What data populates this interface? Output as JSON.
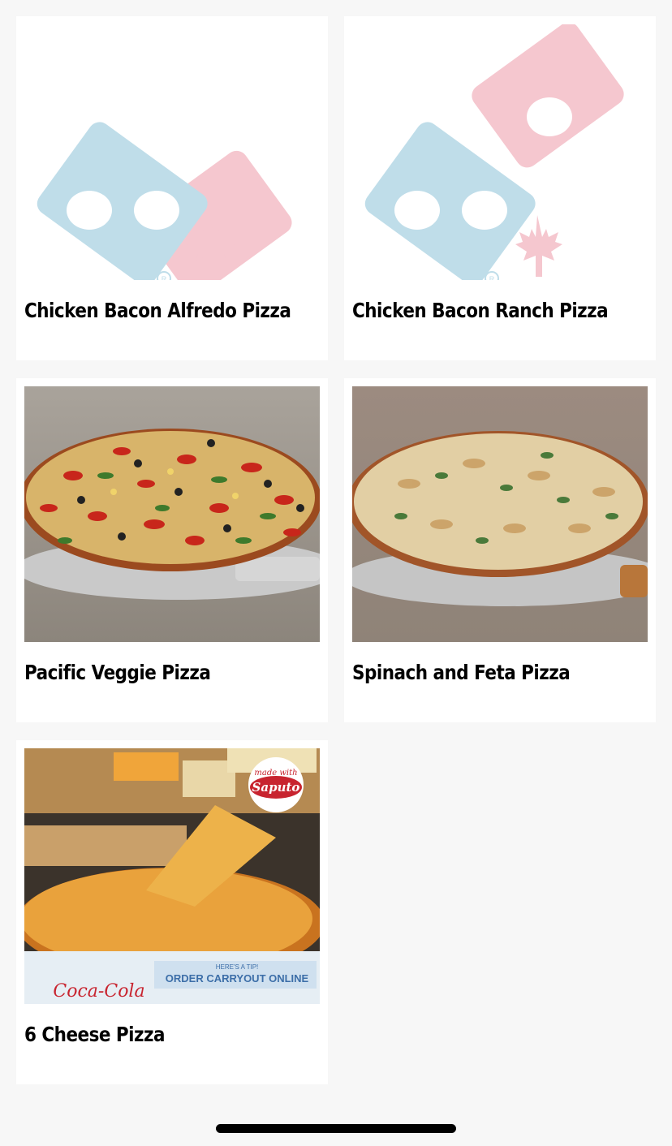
{
  "menu": {
    "items": [
      {
        "name": "Chicken Bacon Alfredo Pizza",
        "image": "dominos-canada-logo-placeholder"
      },
      {
        "name": "Chicken Bacon Ranch Pizza",
        "image": "dominos-canada-logo-placeholder"
      },
      {
        "name": "Pacific Veggie Pizza",
        "image": "pacific-veggie-pizza-photo"
      },
      {
        "name": "Spinach and Feta Pizza",
        "image": "spinach-feta-pizza-photo"
      },
      {
        "name": "6 Cheese Pizza",
        "image": "six-cheese-pizza-photo"
      }
    ]
  },
  "photo_text": {
    "saputo_badge_top": "made with",
    "saputo_badge_brand": "Saputo",
    "box_brand": "Coca-Cola",
    "box_tip_line": "HERE'S A TIP!",
    "box_main_line": "ORDER CARRYOUT ONLINE"
  },
  "colors": {
    "logo_blue": "#bfdde9",
    "logo_red": "#f5c7cf",
    "background": "#f7f7f7",
    "card": "#ffffff"
  }
}
